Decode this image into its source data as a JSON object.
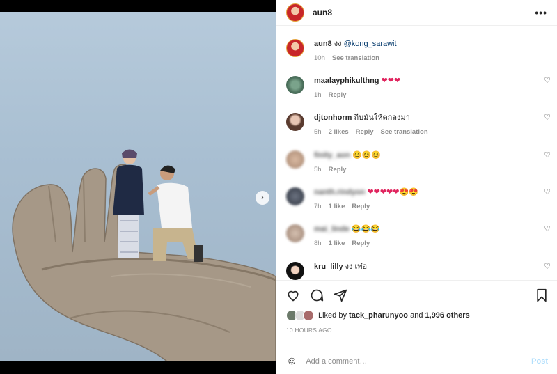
{
  "post": {
    "author": "aun8",
    "caption_user": "aun8",
    "caption_text": "งง",
    "caption_mention": "@kong_sarawit",
    "caption_time": "10h",
    "see_translation": "See translation"
  },
  "comments": [
    {
      "user": "maalayphikulthng",
      "text": "",
      "emoji": "❤❤❤",
      "emoji_color": "#e0245e",
      "time": "1h",
      "likes": "",
      "reply": "Reply",
      "translate": "",
      "blurred": false
    },
    {
      "user": "djtonhorm",
      "text": "ถีบมันให้ตกลงมา",
      "emoji": "",
      "time": "5h",
      "likes": "2 likes",
      "reply": "Reply",
      "translate": "See translation",
      "blurred": false
    },
    {
      "user": "finity_aon",
      "text": "",
      "emoji": "😊😊😊",
      "emoji_color": "#f5c400",
      "time": "5h",
      "likes": "",
      "reply": "Reply",
      "translate": "",
      "blurred": true
    },
    {
      "user": "nanth.rindyon",
      "text": "",
      "emoji": "❤❤❤❤❤😍😍",
      "emoji_color": "#e0245e",
      "time": "7h",
      "likes": "1 like",
      "reply": "Reply",
      "translate": "",
      "blurred": true
    },
    {
      "user": "mai_linde",
      "text": "",
      "emoji": "😂😂😂",
      "emoji_color": "#f5c400",
      "time": "8h",
      "likes": "1 like",
      "reply": "Reply",
      "translate": "",
      "blurred": true
    },
    {
      "user": "kru_lilly",
      "text": "งง เพ๋อ",
      "emoji": "",
      "time": "",
      "likes": "",
      "reply": "",
      "translate": "",
      "blurred": false
    }
  ],
  "likes": {
    "prefix": "Liked by",
    "user": "tack_pharunyoo",
    "and": "and",
    "others": "1,996 others"
  },
  "timestamp": "10 HOURS AGO",
  "add_comment": {
    "placeholder": "Add a comment…",
    "post_label": "Post"
  },
  "colors": {
    "accent": "#0095f6",
    "post_disabled": "#b2dffc",
    "secondary_text": "#8e8e8e",
    "mention": "#00376b"
  },
  "icons": [
    "more-icon",
    "heart-icon",
    "comment-icon",
    "share-icon",
    "save-icon",
    "emoji-icon",
    "next-icon"
  ]
}
